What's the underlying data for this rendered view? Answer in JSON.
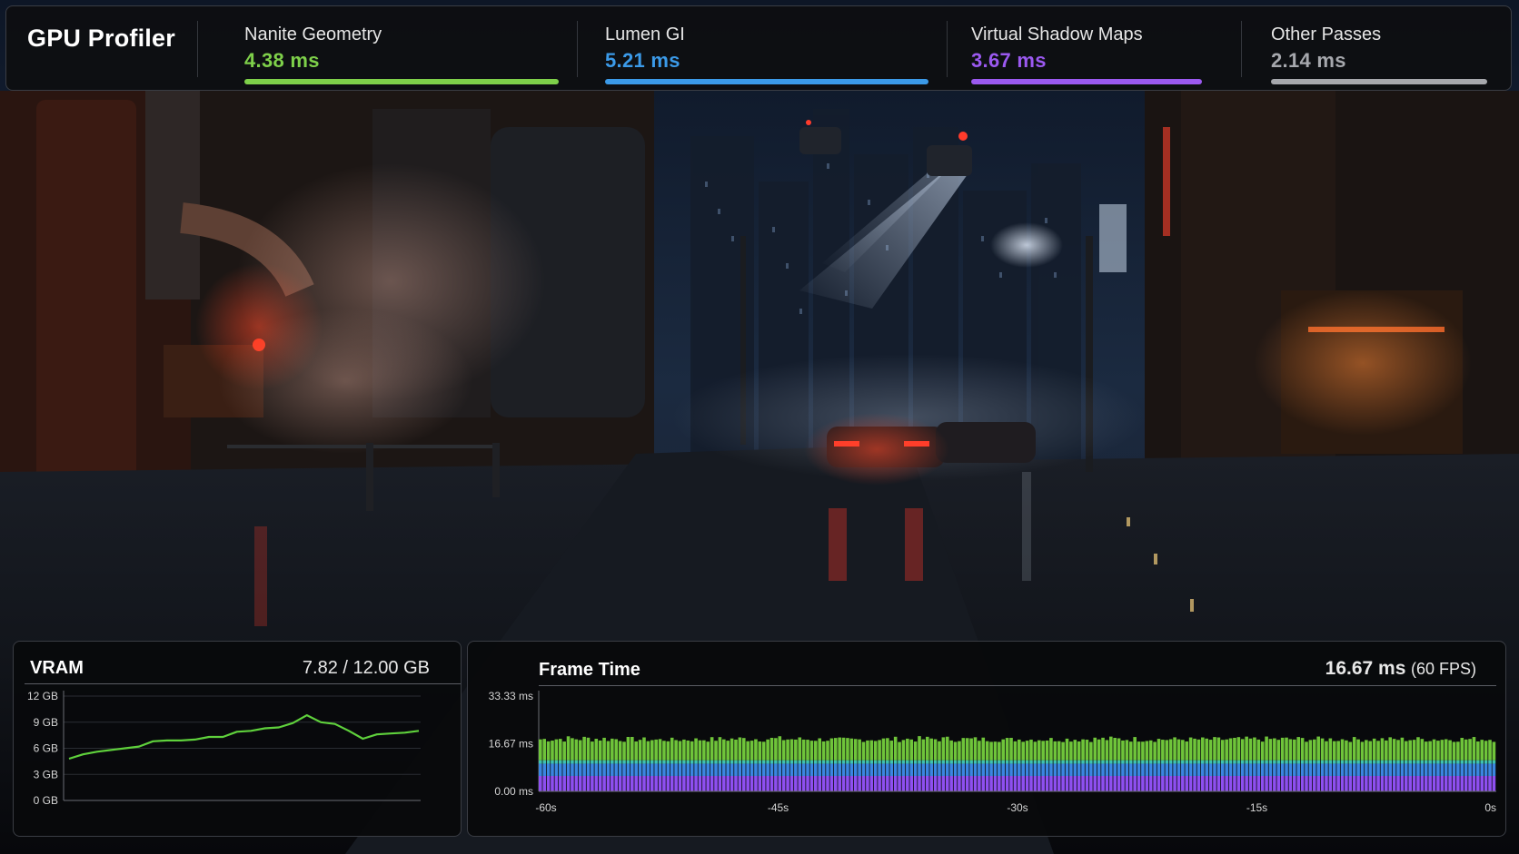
{
  "header": {
    "title": "GPU Profiler",
    "metrics": [
      {
        "label": "Nanite Geometry",
        "value": "4.38 ms",
        "color": "#7ed04a",
        "icon": "",
        "fill": 1.0
      },
      {
        "label": "Lumen GI",
        "value": "5.21 ms",
        "color": "#3b9ae8",
        "fill": 1.0
      },
      {
        "label": "Virtual Shadow Maps",
        "value": "3.67 ms",
        "color": "#9b59f0",
        "fill": 1.0
      },
      {
        "label": "Other Passes",
        "value": "2.14 ms",
        "color": "#a6a8ad",
        "fill": 1.0
      }
    ]
  },
  "vram": {
    "title": "VRAM",
    "summary": "7.82 / 12.00 GB",
    "color": "#5fd13c"
  },
  "frame_time": {
    "title": "Frame Time",
    "summary_value": "16.67 ms",
    "summary_fps": "(60 FPS)"
  },
  "chart_data": [
    {
      "type": "line",
      "title": "VRAM",
      "y_ticks": [
        "12 GB",
        "9 GB",
        "6 GB",
        "3 GB",
        "0 GB"
      ],
      "ylim": [
        0,
        12
      ],
      "grid": true,
      "series": [
        {
          "values": [
            4.8,
            5.3,
            5.6,
            5.8,
            6.0,
            6.2,
            6.8,
            6.9,
            6.9,
            7.0,
            7.3,
            7.3,
            7.9,
            8.0,
            8.3,
            8.4,
            8.9,
            9.8,
            9.0,
            8.8,
            8.0,
            7.1,
            7.6,
            7.7,
            7.8,
            8.0
          ]
        }
      ]
    },
    {
      "type": "bar",
      "title": "Frame Time",
      "stacked": true,
      "y_ticks": [
        "33.33 ms",
        "16.67 ms",
        "0.00 ms"
      ],
      "ylim": [
        0,
        33.33
      ],
      "x_ticks": [
        "-60s",
        "-45s",
        "-30s",
        "-15s",
        "0s"
      ],
      "xlim": [
        -60,
        0
      ],
      "grid": false,
      "bar_count": 240,
      "series": [
        {
          "name": "Virtual Shadow Maps",
          "color": "#8e4ff0",
          "value": 5.4
        },
        {
          "name": "Lumen GI",
          "color": "#3b86e0",
          "value": 4.3
        },
        {
          "name": "Other Passes",
          "color": "#3ec2b0",
          "value": 1.2
        },
        {
          "name": "Nanite Geometry",
          "color": "#6fc43a",
          "value_min": 4.5,
          "value_max": 9.8
        }
      ]
    }
  ]
}
